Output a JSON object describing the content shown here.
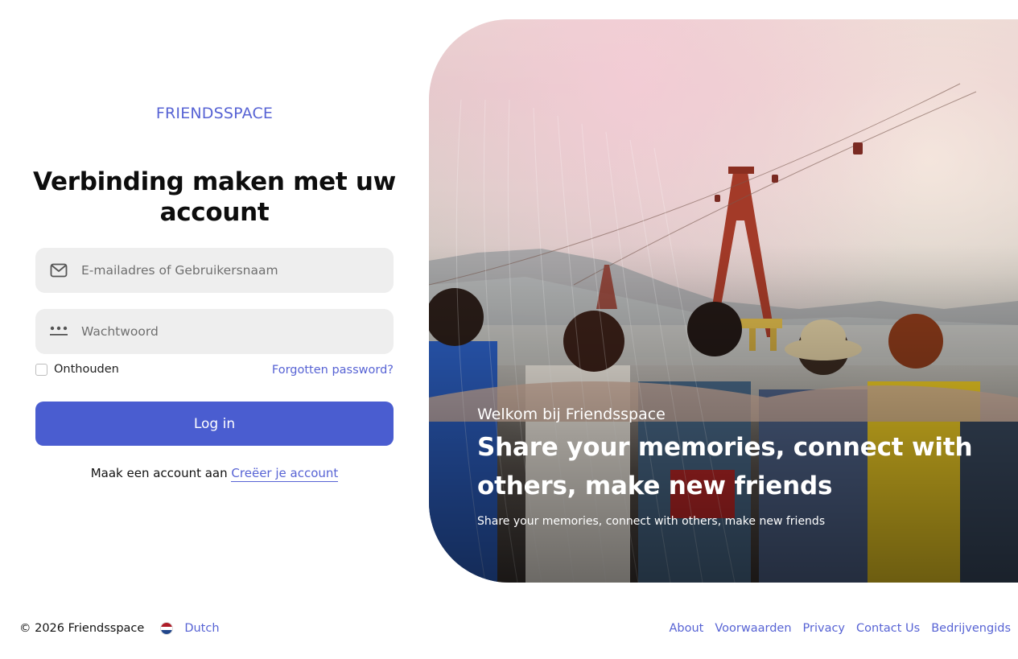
{
  "brand": "FRIENDSSPACE",
  "heading": "Verbinding maken met uw account",
  "form": {
    "email_placeholder": "E-mailadres of Gebruikersnaam",
    "password_placeholder": "Wachtwoord",
    "remember_label": "Onthouden",
    "forgot_label": "Forgotten password?",
    "login_label": "Log in",
    "signup_text": "Maak een account aan",
    "signup_link": "Creëer je account"
  },
  "hero": {
    "welcome": "Welkom bij Friendsspace",
    "title": "Share your memories, connect with others, make new friends",
    "subtitle": "Share your memories, connect with others, make new friends"
  },
  "footer": {
    "copyright": "© 2026 Friendsspace",
    "language": "Dutch",
    "links": [
      "About",
      "Voorwaarden",
      "Privacy",
      "Contact Us",
      "Bedrijvengids"
    ]
  },
  "icons": {
    "email": "envelope-icon",
    "password": "password-dots-icon",
    "flag": "netherlands-flag-icon"
  },
  "colors": {
    "accent": "#5763d4",
    "button": "#4a5dd0",
    "input_bg": "#eeeeee"
  }
}
